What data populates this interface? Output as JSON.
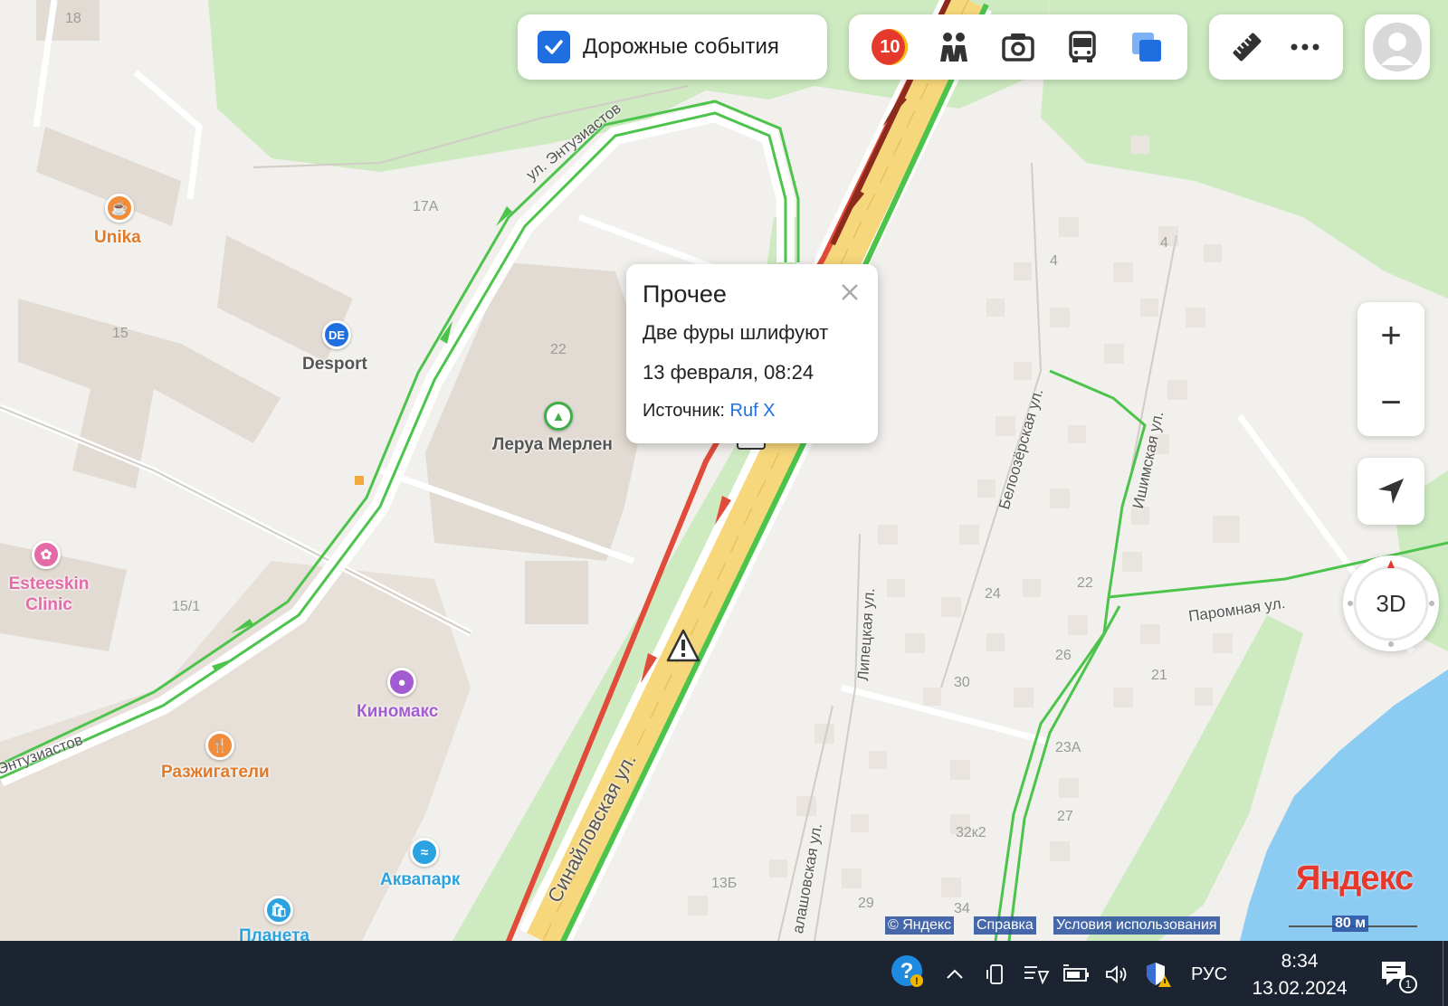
{
  "toolbar": {
    "traffic_events_label": "Дорожные события",
    "traffic_events_checked": true,
    "traffic_score": "10"
  },
  "popup": {
    "category": "Прочее",
    "description": "Две фуры шлифуют",
    "datetime": "13 февраля, 08:24",
    "source_label": "Источник:",
    "source_link": "Ruf X"
  },
  "controls": {
    "zoom_in": "+",
    "zoom_out": "−",
    "view_3d": "3D"
  },
  "pois": {
    "unika": "Unika",
    "desport": "Desport",
    "desport_icon_text": "DE",
    "leroy": "Леруа Мерлен",
    "esteeskin": "Esteeskin Clinic",
    "kinomaks": "Киномакс",
    "razzhigateli": "Разжигатели",
    "akvapark": "Аквапарк",
    "planeta": "Планета"
  },
  "streets": {
    "entuziastov_top": "ул. Энтузиастов",
    "entuziastov_bottom": "Энтузиастов",
    "sinaylovskaya": "Синайловская ул.",
    "beloozerskaya": "Белоозёрская ул.",
    "ishimskaya": "Ишимская ул.",
    "paromnaya": "Паромная ул.",
    "lipetskaya": "Липецкая ул.",
    "balashovskaya": "алашовская ул."
  },
  "house_numbers": {
    "n18": "18",
    "n17a": "17А",
    "n15": "15",
    "n22_lm": "22",
    "n15_1": "15/1",
    "n4a": "4",
    "n4b": "4",
    "n24": "24",
    "n22": "22",
    "n26": "26",
    "n30": "30",
    "n21": "21",
    "n23a": "23А",
    "n27": "27",
    "n32k2": "32к2",
    "n29": "29",
    "n34": "34",
    "n13b": "13Б"
  },
  "attribution": {
    "copyright": "© Яндекс",
    "help": "Справка",
    "terms": "Условия использования",
    "logo": "Яндекс",
    "scale": "80 м"
  },
  "taskbar": {
    "language": "РУС",
    "time": "8:34",
    "date": "13.02.2024",
    "notification_count": "1"
  },
  "colors": {
    "traffic_green": "#4cc44c",
    "traffic_red": "#e04b3a",
    "traffic_darkred": "#8c2a1e",
    "road_yellow": "#f7d77b",
    "park_green": "#cdeac0",
    "water_blue": "#8ccbf2",
    "accent_blue": "#1f6fe0"
  }
}
